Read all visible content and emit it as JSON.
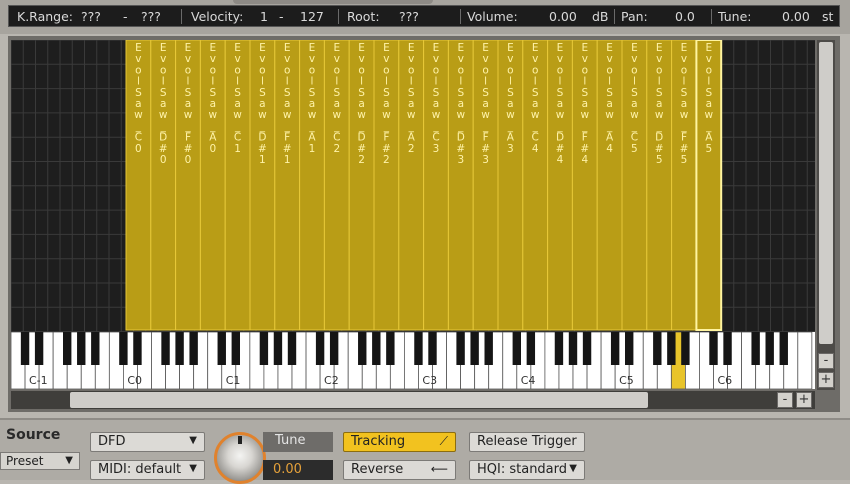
{
  "infobar": {
    "krange_label": "K.Range:",
    "krange_low": "???",
    "krange_dash": "-",
    "krange_high": "???",
    "velocity_label": "Velocity:",
    "velocity_low": "1",
    "velocity_dash": "-",
    "velocity_high": "127",
    "root_label": "Root:",
    "root_value": "???",
    "volume_label": "Volume:",
    "volume_value": "0.00",
    "volume_unit": "dB",
    "pan_label": "Pan:",
    "pan_value": "0.0",
    "tune_label": "Tune:",
    "tune_value": "0.00",
    "tune_unit": "st"
  },
  "zones": [
    {
      "sample": "Evol Saw",
      "note": "C0"
    },
    {
      "sample": "Evol Saw",
      "note": "D#0"
    },
    {
      "sample": "Evol Saw",
      "note": "F#0"
    },
    {
      "sample": "Evol Saw",
      "note": "A0"
    },
    {
      "sample": "Evol Saw",
      "note": "C1"
    },
    {
      "sample": "Evol Saw",
      "note": "D#1"
    },
    {
      "sample": "Evol Saw",
      "note": "F#1"
    },
    {
      "sample": "Evol Saw",
      "note": "A1"
    },
    {
      "sample": "Evol Saw",
      "note": "C2"
    },
    {
      "sample": "Evol Saw",
      "note": "D#2"
    },
    {
      "sample": "Evol Saw",
      "note": "F#2"
    },
    {
      "sample": "Evol Saw",
      "note": "A2"
    },
    {
      "sample": "Evol Saw",
      "note": "C3"
    },
    {
      "sample": "Evol Saw",
      "note": "D#3"
    },
    {
      "sample": "Evol Saw",
      "note": "F#3"
    },
    {
      "sample": "Evol Saw",
      "note": "A3"
    },
    {
      "sample": "Evol Saw",
      "note": "C4"
    },
    {
      "sample": "Evol Saw",
      "note": "D#4"
    },
    {
      "sample": "Evol Saw",
      "note": "F#4"
    },
    {
      "sample": "Evol Saw",
      "note": "A4"
    },
    {
      "sample": "Evol Saw",
      "note": "C5"
    },
    {
      "sample": "Evol Saw",
      "note": "D#5"
    },
    {
      "sample": "Evol Saw",
      "note": "F#5"
    },
    {
      "sample": "Evol Saw",
      "note": "A5"
    }
  ],
  "selected_zone": 23,
  "keyboard": {
    "octave_labels": [
      "C-1",
      "C0",
      "C1",
      "C2",
      "C3",
      "C4",
      "C5",
      "C6"
    ],
    "highlighted_key": "A5"
  },
  "scroll": {
    "plus": "+",
    "minus": "-"
  },
  "bottom": {
    "source_label": "Source",
    "preset_label": "Preset",
    "dfd_label": "DFD",
    "midi_label": "MIDI: default",
    "tune_label": "Tune",
    "tune_value": "0.00",
    "tracking_label": "Tracking",
    "reverse_label": "Reverse",
    "release_trigger_label": "Release Trigger",
    "hqi_label": "HQI: standard"
  },
  "colors": {
    "zone_fill": "#b99d16",
    "zone_border": "#e6c838",
    "zone_text": "#fff3a8",
    "tracking_button": "#f2c21f",
    "knob_ring": "#e0822d",
    "key_highlight": "#e8c42a"
  }
}
